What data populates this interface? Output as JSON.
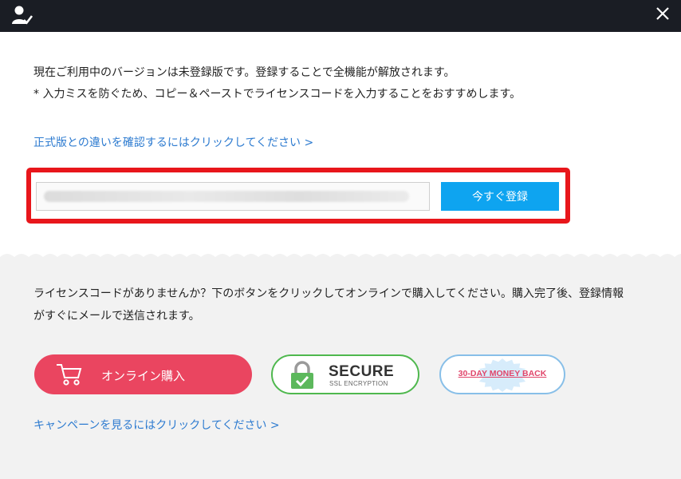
{
  "titlebar": {
    "user_icon": "user-check-icon",
    "close_icon": "close-icon",
    "background": "#1a1d24"
  },
  "main": {
    "intro_line1": "現在ご利用中のバージョンは未登録版です。登録することで全機能が解放されます。",
    "intro_line2": "* 入力ミスを防ぐため、コピー＆ペーストでライセンスコードを入力することをおすすめします。",
    "diff_link": "正式版との違いを確認するにはクリックしてください >",
    "license_input": {
      "value": "",
      "blurred": true
    },
    "register_button": "今すぐ登録",
    "highlight_color": "#e8161b",
    "accent_color": "#0ea4f0",
    "link_color": "#2d7bd0"
  },
  "purchase": {
    "text_line1": "ライセンスコードがありませんか？下のボタンをクリックしてオンラインで購入してください。購入完了後、登録情報",
    "text_line2": "がすぐにメールで送信されます。",
    "buy_button": "オンライン購入",
    "buy_icon": "shopping-cart-icon",
    "buy_color": "#ea4560",
    "secure_badge": {
      "title": "SECURE",
      "subtitle": "SSL ENCRYPTION",
      "icon": "padlock-check-icon",
      "color": "#4fb84e"
    },
    "money_back_badge": {
      "text": "30-DAY MONEY BACK",
      "color": "#e0456a"
    },
    "campaign_link": "キャンペーンを見るにはクリックしてください >"
  }
}
